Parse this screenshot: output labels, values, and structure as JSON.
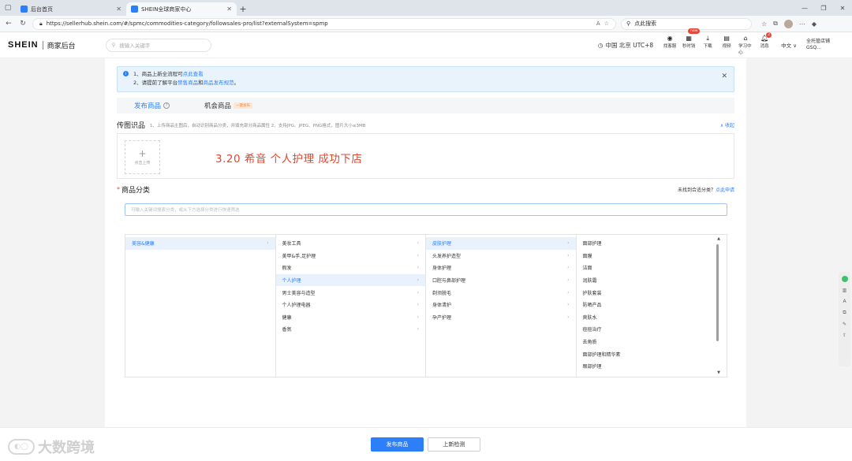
{
  "browser": {
    "tabs": [
      {
        "title": "后台首页",
        "active": false
      },
      {
        "title": "SHEIN全球商家中心",
        "active": true
      }
    ],
    "url": "https://sellerhub.shein.com/#/spmc/commodities-category/followsales-pro/list?externalSystem=spmp",
    "search_placeholder": "点此搜索"
  },
  "header": {
    "logo": "SHEIN",
    "subtitle": "商家后台",
    "search_placeholder": "搜输入关键字",
    "timezone": "中国 北京 UTC+8",
    "tools": [
      {
        "label": "找客服",
        "icon": "headset-icon",
        "badge": ""
      },
      {
        "label": "秒时钱",
        "icon": "grid-icon",
        "badge": "new"
      },
      {
        "label": "下载",
        "icon": "download-icon",
        "badge": ""
      },
      {
        "label": "视频",
        "icon": "document-icon",
        "badge": ""
      },
      {
        "label": "学习中心",
        "icon": "graduation-icon",
        "badge": ""
      },
      {
        "label": "消息",
        "icon": "bell-icon",
        "badge": "2"
      }
    ],
    "language": "中文 ∨",
    "store_line1": "全托管店铺",
    "store_line2": "GSQ..."
  },
  "notice": {
    "line1_prefix": "1、商品上新全流程可",
    "line1_link": "点此查看",
    "line2_prefix": "2、请提前了解平台",
    "line2_link1": "禁售商品",
    "line2_mid": "和",
    "line2_link2": "商品发布规范",
    "line2_suffix": "。"
  },
  "publish_tabs": [
    {
      "label": "发布商品",
      "active": true,
      "hint": "?"
    },
    {
      "label": "机会商品",
      "active": false,
      "badge": "一键发布"
    }
  ],
  "image_section": {
    "title": "传图识品",
    "description": "1、上传商品主图后，自动识别商品分类，并填充部分商品属性   2、支持JPG、JPEG、PNG格式，图片大小≤3MB",
    "collapse_label": "∧ 收起",
    "upload_label": "点击上传"
  },
  "overlay_text": "3.20  希音 个人护理 成功下店",
  "category": {
    "title": "商品分类",
    "right_text": "未找到合适分类？",
    "right_link": "点此申请",
    "search_placeholder": "可输入关键词搜索分类，或从下方选择分类进行快速筛选",
    "columns": [
      [
        {
          "label": "美容&健康",
          "selected": true
        }
      ],
      [
        {
          "label": "美妆工具",
          "selected": false
        },
        {
          "label": "美甲&手,足护理",
          "selected": false
        },
        {
          "label": "假发",
          "selected": false
        },
        {
          "label": "个人护理",
          "selected": true
        },
        {
          "label": "男士美容与造型",
          "selected": false
        },
        {
          "label": "个人护理电器",
          "selected": false
        },
        {
          "label": "健康",
          "selected": false
        },
        {
          "label": "香氛",
          "selected": false
        }
      ],
      [
        {
          "label": "皮肤护理",
          "selected": true
        },
        {
          "label": "头发养护造型",
          "selected": false
        },
        {
          "label": "身体护理",
          "selected": false
        },
        {
          "label": "口腔与鼻部护理",
          "selected": false
        },
        {
          "label": "剃须脱毛",
          "selected": false
        },
        {
          "label": "身体清护",
          "selected": false
        },
        {
          "label": "孕产护理",
          "selected": false
        }
      ],
      [
        {
          "label": "面部护理"
        },
        {
          "label": "面膜"
        },
        {
          "label": "洁面"
        },
        {
          "label": "润肤霜"
        },
        {
          "label": "护肤套装"
        },
        {
          "label": "防晒产品"
        },
        {
          "label": "爽肤水"
        },
        {
          "label": "痘痘治疗"
        },
        {
          "label": "去角质"
        },
        {
          "label": "面部护理和精华素"
        },
        {
          "label": "眼部护理"
        }
      ]
    ]
  },
  "footer": {
    "primary_button": "发布商品",
    "secondary_button": "上新检测",
    "watermark": "大数跨境"
  }
}
